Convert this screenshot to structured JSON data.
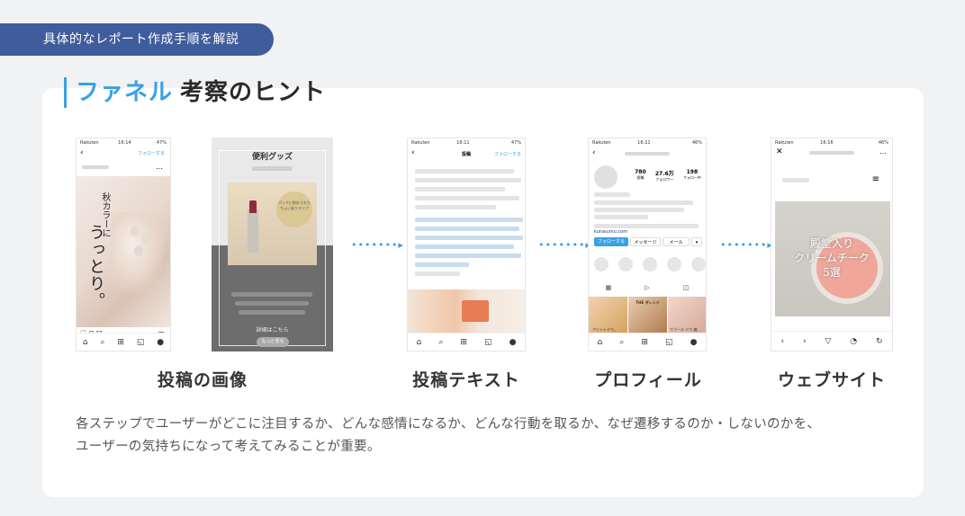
{
  "tag_label": "具体的なレポート作成手順を解説",
  "heading": {
    "accent": "ファネル",
    "rest": "考察のヒント"
  },
  "steps": [
    {
      "label": "投稿の画像"
    },
    {
      "label": "投稿テキスト"
    },
    {
      "label": "プロフィール"
    },
    {
      "label": "ウェブサイト"
    }
  ],
  "description": [
    "各ステップでユーザーがどこに注目するか、どんな感情になるか、どんな行動を取るか、なぜ遷移するのか・しないのかを、",
    "ユーザーの気持ちになって考えてみることが重要。"
  ],
  "phone1": {
    "status_left": "Rakuten",
    "status_time": "16:14",
    "status_right": "47%",
    "follow": "フォローする",
    "text_small": "秋カラーに",
    "text_large": "うっとり。"
  },
  "phone2": {
    "title": "便利グッズ",
    "bottle_text": "パッケに統計されたちょい塗りタイプ",
    "caption": "詳細はこちら",
    "more_button": "もっと見る"
  },
  "phone3": {
    "status_left": "Rakuten",
    "status_time": "16:11",
    "status_right": "47%",
    "header": "投稿",
    "follow": "フォローする"
  },
  "phone4": {
    "status_left": "Rakuten",
    "status_time": "16:11",
    "status_right": "46%",
    "stats": [
      {
        "value": "780",
        "label": "投稿"
      },
      {
        "value": "27.6万",
        "label": "フォロワー"
      },
      {
        "value": "198",
        "label": "フォロー中"
      }
    ],
    "site": "kurasumu.com",
    "follow_button": "フォローする",
    "message_button": "メッセージ",
    "mail_button": "メール",
    "thumb2_label": "THE ダレンジ",
    "thumb2_sub": "アイシャドウ。",
    "thumb3_sub": "ガブール ドウ 編"
  },
  "phone5": {
    "status_left": "Rakuten",
    "status_time": "16:16",
    "status_right": "46%",
    "overlay": [
      "殿堂入り",
      "クリームチーク",
      "5選"
    ]
  },
  "colors": {
    "accent": "#3aa0e6",
    "tag_bg": "#3f5d9c"
  }
}
